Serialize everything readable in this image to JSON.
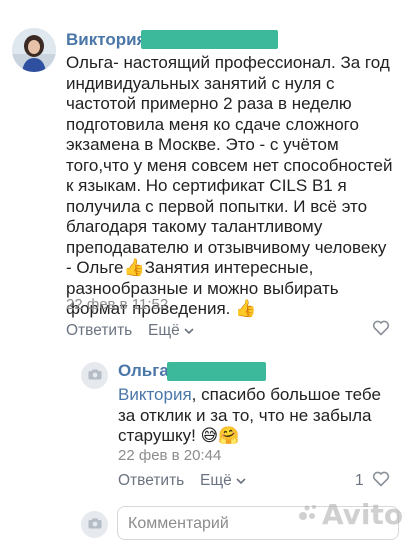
{
  "comment": {
    "author": "Виктория",
    "text": "Ольга- настоящий профессионал. За год индивидуальных занятий с нуля с частотой примерно 2 раза в неделю подготовила меня ко сдаче сложного экзамена в Москве. Это - с учётом того,что у меня совсем нет способностей к языкам. Но сертификат CILS B1 я получила с первой попытки. И всё это благодаря такому талантливому преподавателю и отзывчивому человеку - Ольге",
    "text_tail": "Занятия интересные, разнообразные и можно выбирать формат проведения.",
    "date": "22 фев в 11:52",
    "reply_label": "Ответить",
    "more_label": "Ещё"
  },
  "reply": {
    "author": "Ольга",
    "mention": "Виктория",
    "text": ", спасибо большое тебе за отклик и за то, что не забыла старушку!",
    "date": "22 фев в 20:44",
    "reply_label": "Ответить",
    "more_label": "Ещё",
    "likes": "1"
  },
  "composer": {
    "placeholder": "Комментарий"
  },
  "watermark": "Avito",
  "colors": {
    "link": "#4a76a8",
    "name_mask": "#3cb99a"
  }
}
